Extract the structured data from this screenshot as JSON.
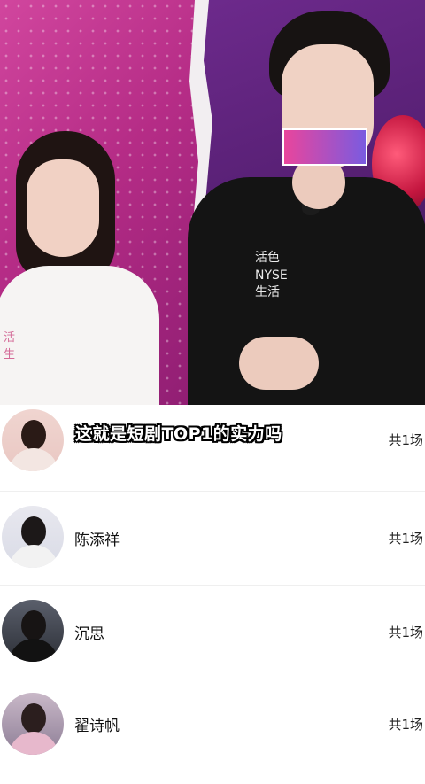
{
  "video": {
    "subtitle": "这就是短剧TOP1的实力吗",
    "shirt_logo_woman": "活\n生",
    "shirt_logo_man": "活色\nNYSE\n生活"
  },
  "list": {
    "items": [
      {
        "name": "",
        "count": "共1场",
        "avatar": "woman-avatar"
      },
      {
        "name": "陈添祥",
        "count": "共1场",
        "avatar": "man-avatar"
      },
      {
        "name": "沉思",
        "count": "共1场",
        "avatar": "man-avatar"
      },
      {
        "name": "翟诗帆",
        "count": "共1场",
        "avatar": "woman-avatar"
      }
    ]
  },
  "colors": {
    "bg_pink": "#c23a90",
    "bg_purple": "#5a2177",
    "text_primary": "#111111",
    "divider": "#efefef"
  }
}
